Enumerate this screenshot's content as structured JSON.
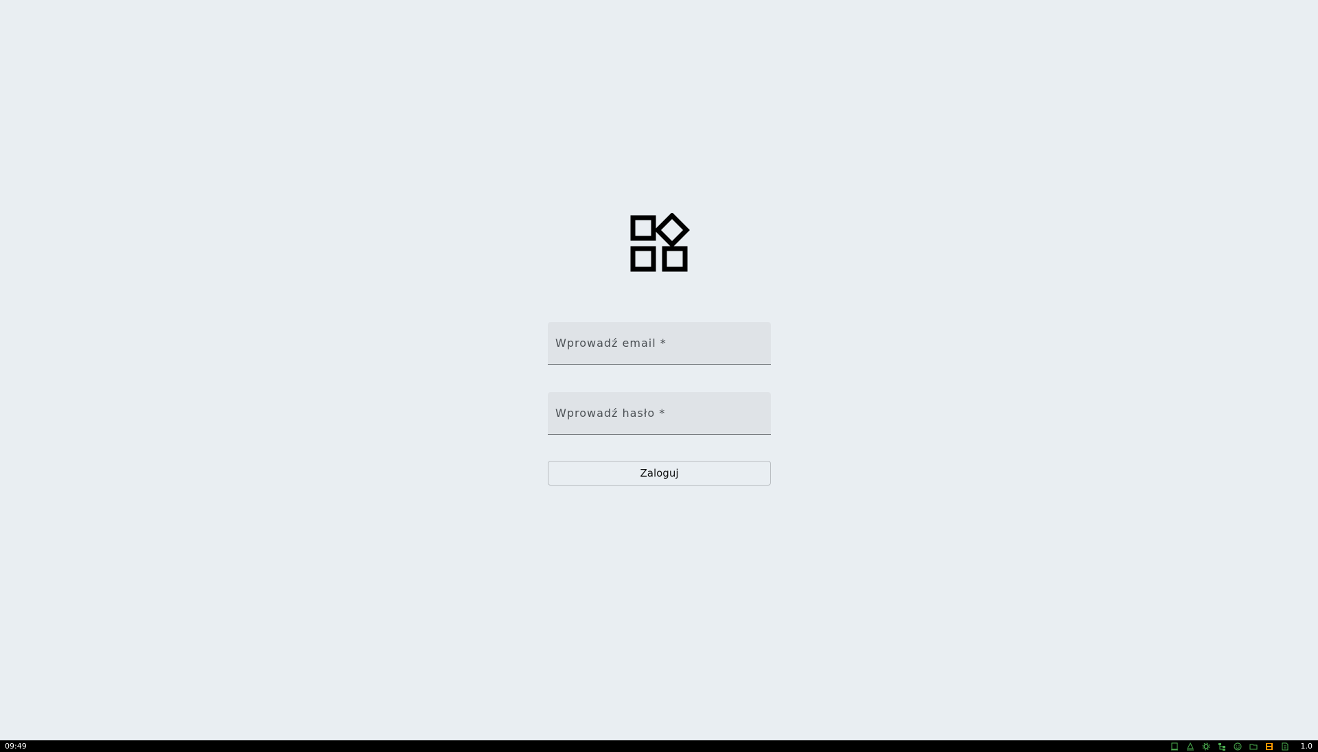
{
  "login": {
    "email_placeholder": "Wprowadź email *",
    "password_placeholder": "Wprowadź hasło *",
    "login_button_label": "Zaloguj"
  },
  "logo": {
    "icon_name": "apps-widget-icon",
    "color": "#000000"
  },
  "taskbar": {
    "time": "09:49",
    "tray_icons": [
      "server-icon",
      "network-tree-icon",
      "settings-icon",
      "hierarchy-icon",
      "emoji-icon",
      "folder-icon",
      "save-icon",
      "document-icon"
    ],
    "version": "1.0"
  },
  "colors": {
    "background": "#e9eef2",
    "field_background": "#dfe3e7",
    "tray_green": "#4caf50",
    "tray_orange": "#ff9800"
  }
}
